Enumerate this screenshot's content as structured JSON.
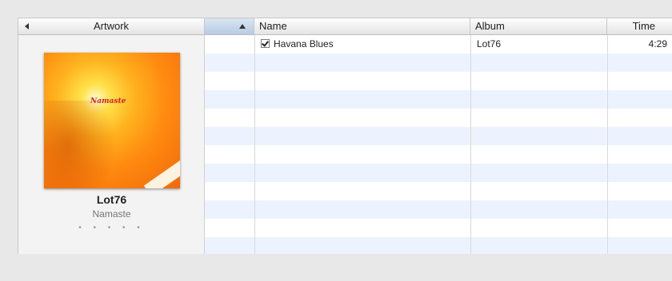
{
  "header": {
    "artwork_label": "Artwork",
    "name_label": "Name",
    "album_label": "Album",
    "time_label": "Time"
  },
  "artwork_pane": {
    "artist": "Lot76",
    "album": "Namaste",
    "rating_dots": "• • • • •",
    "cover_logo": "Namaste"
  },
  "tracks": [
    {
      "checked": true,
      "name": "Havana Blues",
      "album": "Lot76",
      "time": "4:29"
    }
  ],
  "colors": {
    "row_stripe": "#edf3fe",
    "sorted_header": "#b7cbe3"
  }
}
